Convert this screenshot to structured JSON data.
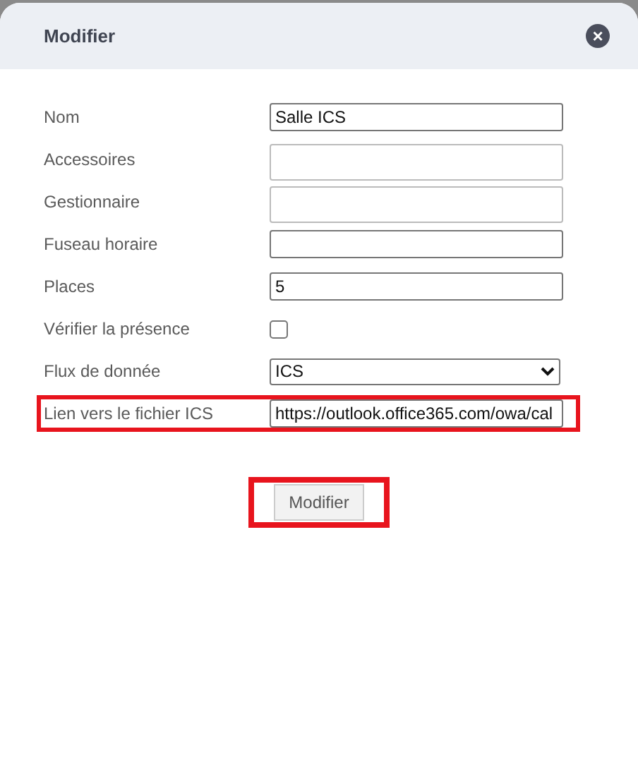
{
  "dialog": {
    "title": "Modifier",
    "close_symbol": "×"
  },
  "fields": [
    {
      "kind": "text",
      "label": "Nom",
      "value": "Salle ICS",
      "highlighted": false
    },
    {
      "kind": "textarea",
      "label": "Accessoires",
      "highlighted": false
    },
    {
      "kind": "textarea",
      "label": "Gestionnaire",
      "highlighted": false
    },
    {
      "kind": "text",
      "label": "Fuseau horaire",
      "highlighted": false
    },
    {
      "kind": "text",
      "label": "Places",
      "value": "5",
      "highlighted": false
    },
    {
      "kind": "checkbox",
      "label": "Vérifier la présence",
      "checked": false,
      "highlighted": false
    },
    {
      "kind": "select",
      "label": "Flux de donnée",
      "value": "ICS",
      "highlighted": false
    },
    {
      "kind": "text",
      "label": "Lien vers le fichier ICS",
      "value": "https://outlook.office365.com/owa/cal",
      "highlighted": true
    }
  ],
  "submit_button": {
    "label": "Modifier",
    "highlighted": true
  }
}
